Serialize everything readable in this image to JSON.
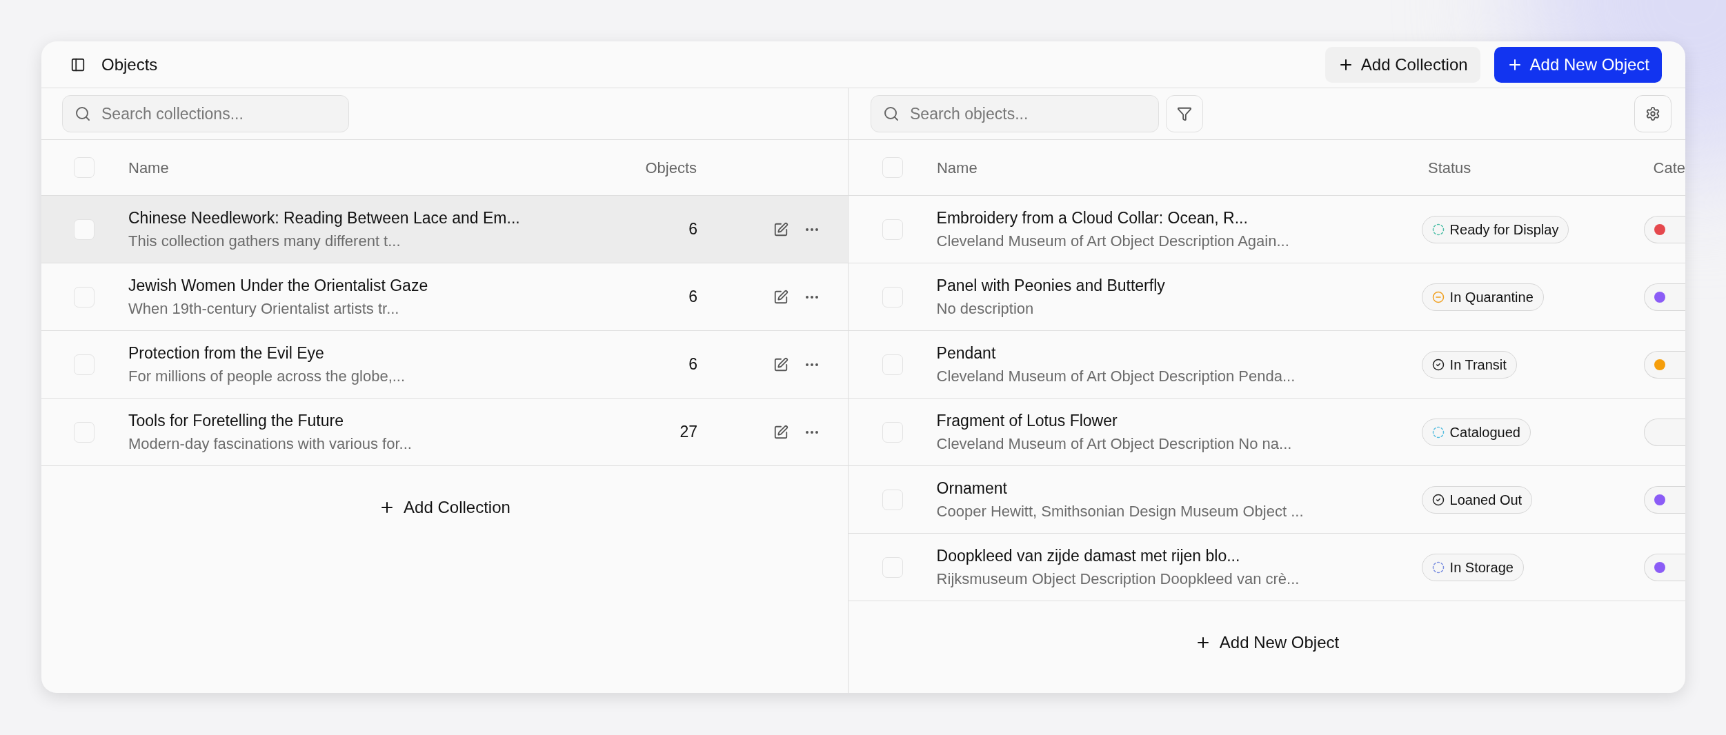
{
  "header": {
    "title": "Objects",
    "buttons": [
      {
        "label": "Add Collection",
        "kind": "secondary"
      },
      {
        "label": "Add New Object",
        "kind": "primary"
      }
    ]
  },
  "collections": {
    "search": {
      "placeholder": "Search collections..."
    },
    "select_all_checked": false,
    "columns": [
      "Name",
      "Objects"
    ],
    "rows": [
      {
        "name": "Chinese Needlework: Reading Between Lace and Em...",
        "description": "This collection gathers many different t...",
        "count": "6",
        "selected": true,
        "checked": false
      },
      {
        "name": "Jewish Women Under the Orientalist Gaze",
        "description": "When 19th-century Orientalist artists tr...",
        "count": "6",
        "selected": false,
        "checked": false
      },
      {
        "name": "Protection from the Evil Eye",
        "description": "For millions of people across the globe,...",
        "count": "6",
        "selected": false,
        "checked": false
      },
      {
        "name": "Tools for Foretelling the Future",
        "description": "Modern-day fascinations with various for...",
        "count": "27",
        "selected": false,
        "checked": false
      }
    ],
    "add_label": "Add Collection"
  },
  "objects": {
    "search": {
      "placeholder": "Search objects..."
    },
    "select_all_checked": false,
    "columns": [
      "Name",
      "Status",
      "Cate"
    ],
    "rows": [
      {
        "name": "Embroidery from a Cloud Collar: Ocean, R...",
        "description": "Cleveland Museum of Art Object Description Again...",
        "status": {
          "label": "Ready for Display",
          "kind": "dashed",
          "color": "#4fbfa8"
        },
        "category": {
          "color": "#e5484d"
        },
        "checked": false
      },
      {
        "name": "Panel with Peonies and Butterfly",
        "description": "No description",
        "status": {
          "label": "In Quarantine",
          "kind": "minus",
          "color": "#f0a020"
        },
        "category": {
          "color": "#8b5cf6"
        },
        "checked": false
      },
      {
        "name": "Pendant",
        "description": "Cleveland Museum of Art Object Description Penda...",
        "status": {
          "label": "In Transit",
          "kind": "check",
          "color": "#222222"
        },
        "category": {
          "color": "#f59e0b"
        },
        "checked": false
      },
      {
        "name": "Fragment of Lotus Flower",
        "description": "Cleveland Museum of Art Object Description No na...",
        "status": {
          "label": "Catalogued",
          "kind": "dashed",
          "color": "#5bbfe0"
        },
        "category": {},
        "checked": false
      },
      {
        "name": "Ornament",
        "description": "Cooper Hewitt, Smithsonian Design Museum Object ...",
        "status": {
          "label": "Loaned Out",
          "kind": "check",
          "color": "#222222"
        },
        "category": {
          "color": "#8b5cf6"
        },
        "checked": false
      },
      {
        "name": "Doopkleed van zijde damast met rijen blo...",
        "description": "Rijksmuseum Object Description Doopkleed van crè...",
        "status": {
          "label": "In Storage",
          "kind": "dashed",
          "color": "#7b8fe0"
        },
        "category": {
          "color": "#8b5cf6"
        },
        "checked": false
      }
    ],
    "add_label": "Add New Object"
  }
}
